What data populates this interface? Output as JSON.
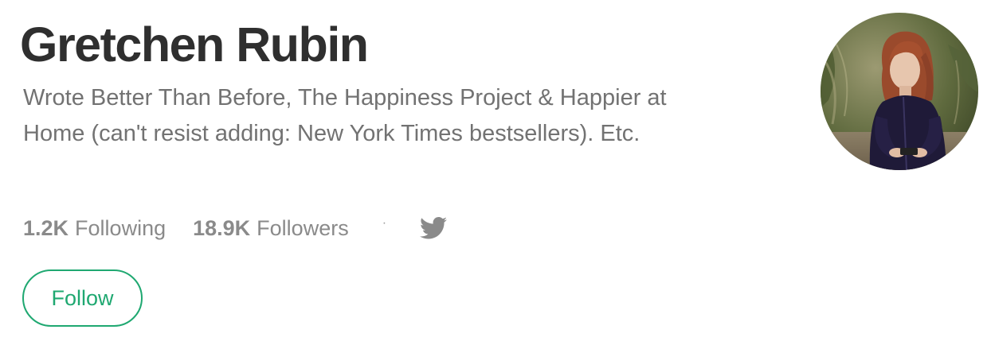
{
  "profile": {
    "name": "Gretchen Rubin",
    "bio": "Wrote Better Than Before, The Happiness Project & Happier at Home (can't resist adding: New York Times bestsellers). Etc."
  },
  "stats": {
    "following_count": "1.2K",
    "following_label": "Following",
    "followers_count": "18.9K",
    "followers_label": "Followers",
    "separator": "·",
    "social_icon": "twitter-icon"
  },
  "actions": {
    "follow_label": "Follow"
  },
  "colors": {
    "name": "#2f2f2f",
    "bio": "#727272",
    "stats": "#8a8a8a",
    "accent": "#1fa871"
  }
}
